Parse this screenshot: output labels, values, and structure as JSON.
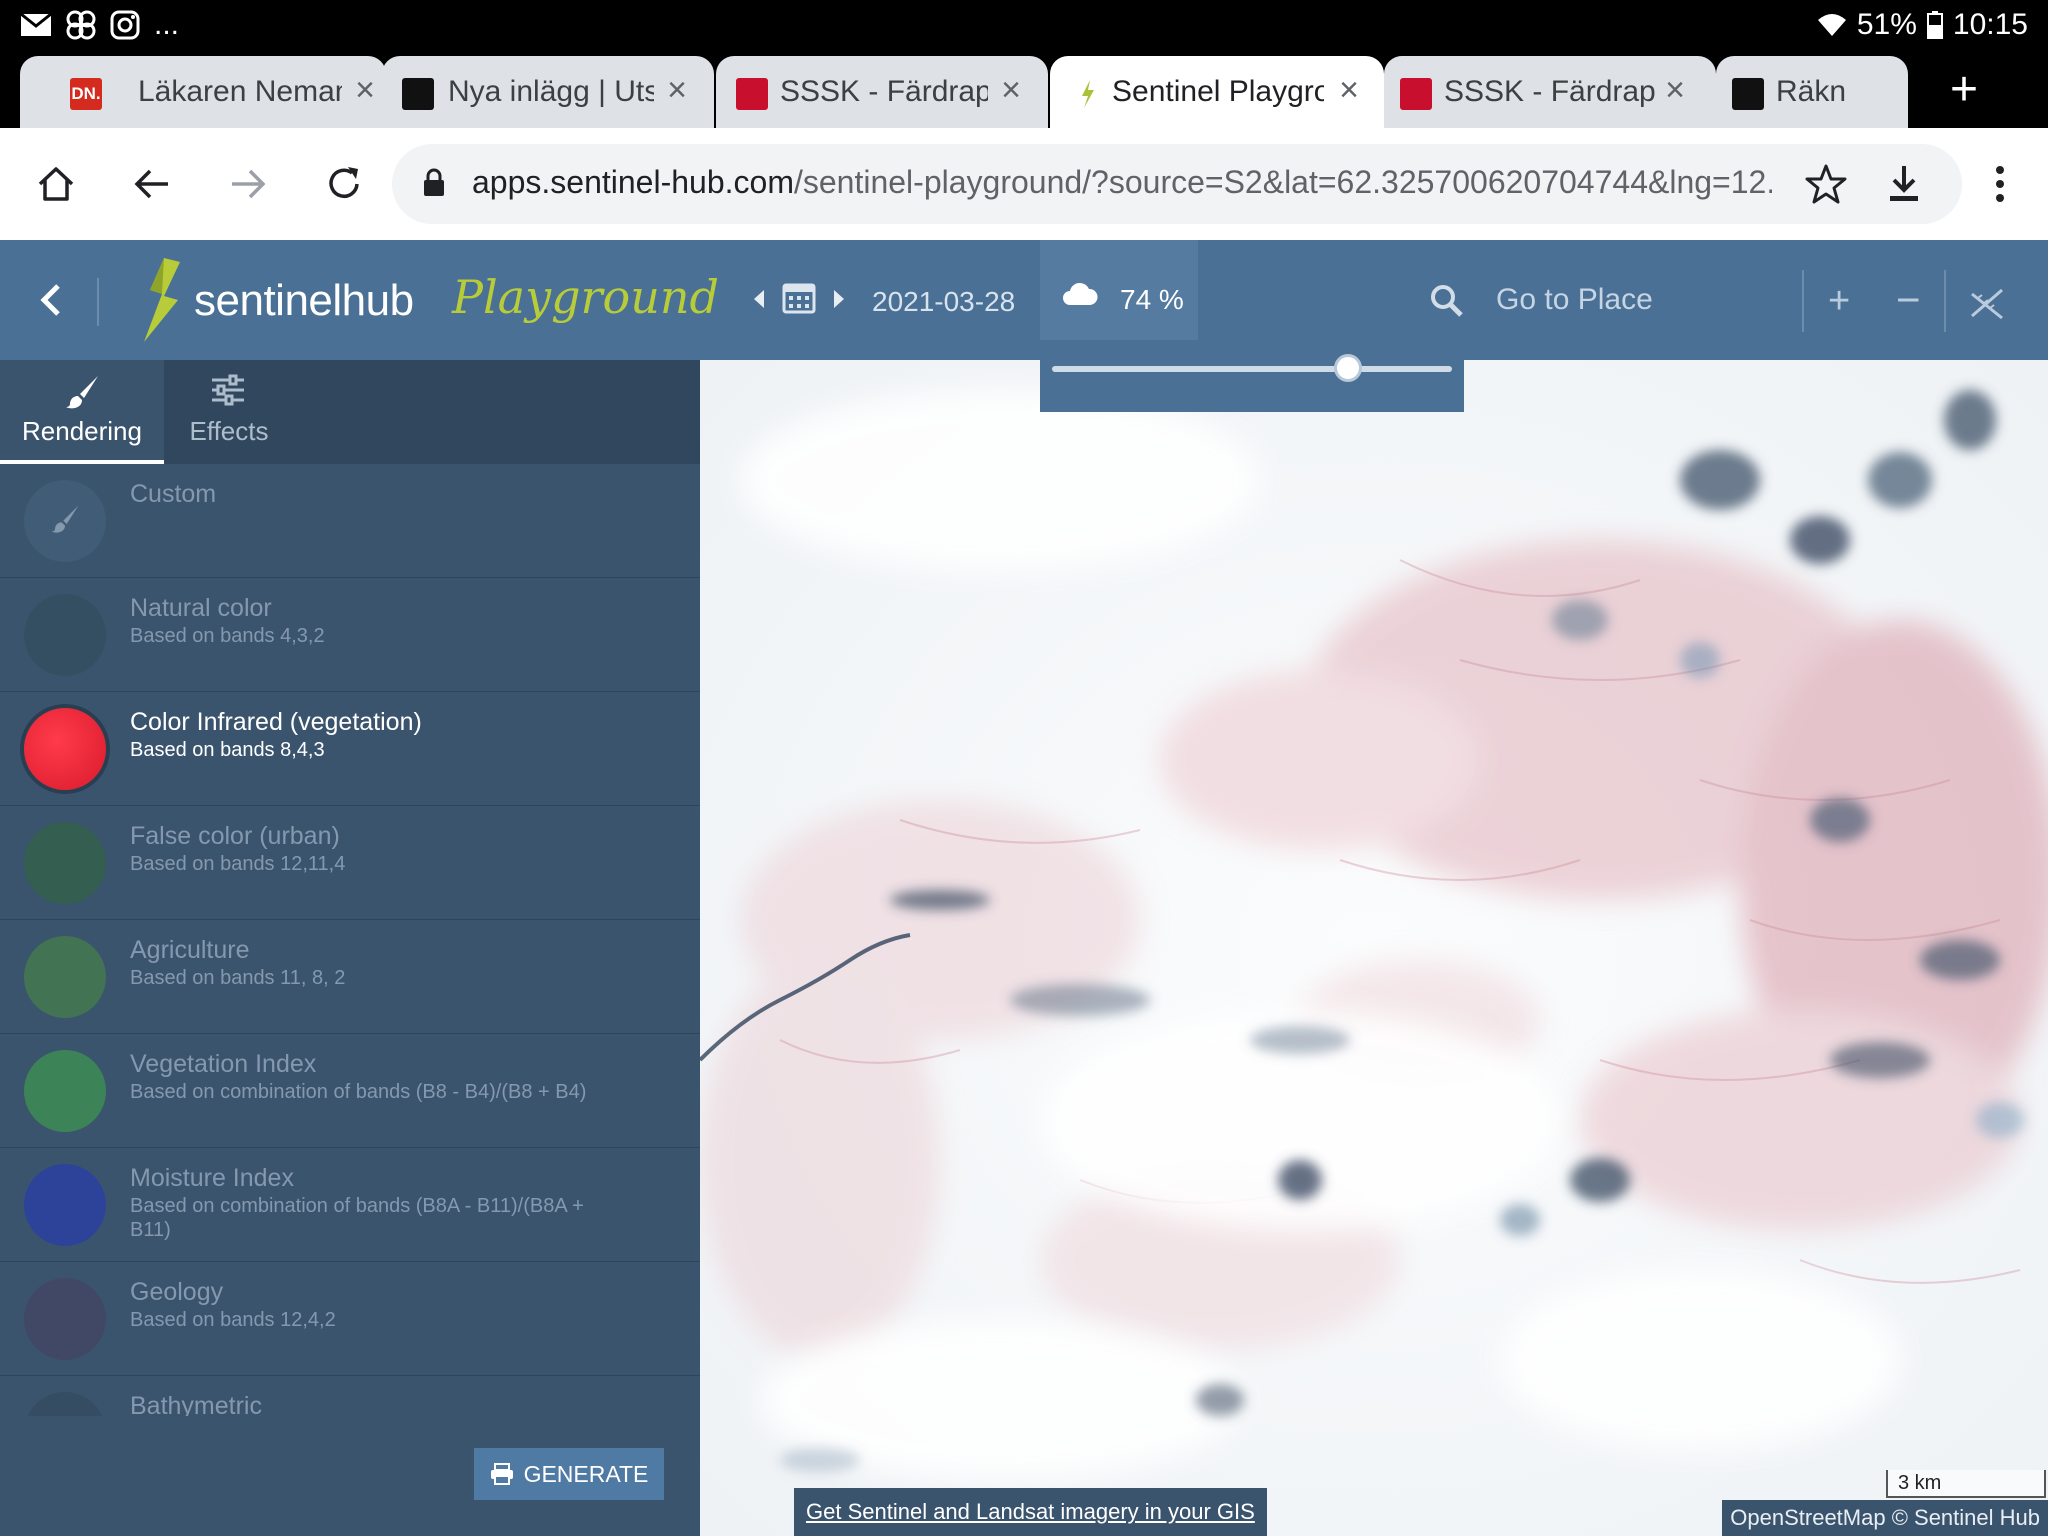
{
  "status_bar": {
    "battery": "51%",
    "time": "10:15",
    "more": "..."
  },
  "browser": {
    "tabs": [
      {
        "title": "Läkaren Nemam",
        "favicon_text": "DN."
      },
      {
        "title": "Nya inlägg | Utsi"
      },
      {
        "title": "SSSK - Färdrapp"
      },
      {
        "title": "Sentinel Playgro"
      },
      {
        "title": "SSSK - Färdrapp"
      },
      {
        "title": "Räkn"
      }
    ],
    "url_host": "apps.sentinel-hub.com",
    "url_path": "/sentinel-playground/?source=S2&lat=62.325700620704744&lng=12."
  },
  "header": {
    "logo_text": "sentinelhub",
    "logo_script": "Playground",
    "date": "2021-03-28",
    "cloud_coverage": "74 %",
    "cloud_slider_fraction": 0.74,
    "search_placeholder": "Go to Place",
    "zoom_in": "+",
    "zoom_out": "−"
  },
  "sidebar": {
    "tabs": [
      {
        "label": "Rendering"
      },
      {
        "label": "Effects"
      }
    ],
    "layers": [
      {
        "name": "Custom",
        "desc": "",
        "color": "#3b546d"
      },
      {
        "name": "Natural color",
        "desc": "Based on bands 4,3,2",
        "color": "#2f4a55"
      },
      {
        "name": "Color Infrared (vegetation)",
        "desc": "Based on bands 8,4,3",
        "color": "#e8273a"
      },
      {
        "name": "False color (urban)",
        "desc": "Based on bands 12,11,4",
        "color": "#2b6b2c"
      },
      {
        "name": "Agriculture",
        "desc": "Based on bands 11, 8, 2",
        "color": "#4c9a33"
      },
      {
        "name": "Vegetation Index",
        "desc": "Based on combination of bands (B8 - B4)/(B8 + B4)",
        "color": "#3fbf3f"
      },
      {
        "name": "Moisture Index",
        "desc": "Based on combination of bands (B8A - B11)/(B8A + B11)",
        "color": "#1d2fd0"
      },
      {
        "name": "Geology",
        "desc": "Based on bands 12,4,2",
        "color": "#4a3a5e"
      },
      {
        "name": "Bathymetric",
        "desc": "",
        "color": "#2d4456"
      }
    ],
    "generate_label": "GENERATE"
  },
  "map": {
    "gis_link": "Get Sentinel and Landsat imagery in your GIS",
    "scale_label": "3 km",
    "attribution": "OpenStreetMap © Sentinel Hub"
  }
}
